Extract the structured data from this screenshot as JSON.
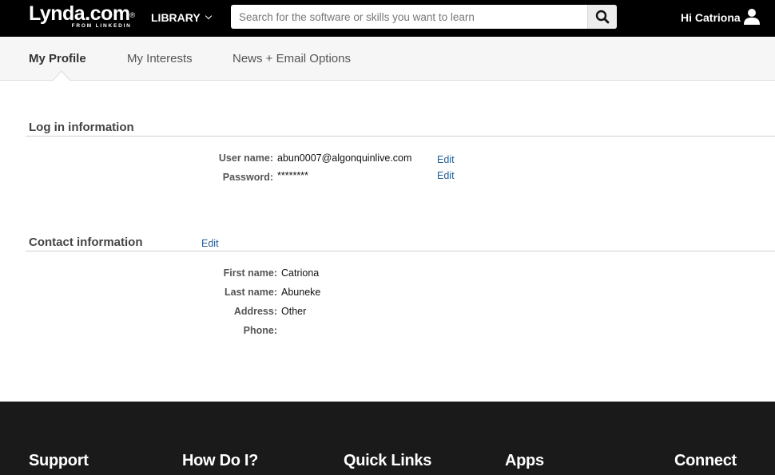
{
  "header": {
    "logo_main": "Lynda.com",
    "logo_reg": "®",
    "logo_sub": "FROM LINKEDIN",
    "library_label": "LIBRARY",
    "search_placeholder": "Search for the software or skills you want to learn",
    "search_value": "",
    "greeting": "Hi Catriona",
    "icons": {
      "search": "search-icon",
      "user": "user-icon",
      "library": "chevron-down-icon"
    }
  },
  "tabs": [
    {
      "label": "My Profile",
      "active": true
    },
    {
      "label": "My Interests",
      "active": false
    },
    {
      "label": "News + Email Options",
      "active": false
    }
  ],
  "login": {
    "title": "Log in information",
    "username_label": "User name:",
    "username_value": "abun0007@algonquinlive.com",
    "password_label": "Password:",
    "password_value": "********",
    "edit_label": "Edit"
  },
  "contact": {
    "title": "Contact information",
    "edit_label": "Edit",
    "fields": [
      {
        "label": "First name:",
        "value": "Catriona"
      },
      {
        "label": "Last name:",
        "value": "Abuneke"
      },
      {
        "label": "Address:",
        "value": "Other"
      },
      {
        "label": "Phone:",
        "value": ""
      }
    ]
  },
  "footer": {
    "headings": [
      "Support",
      "How Do I?",
      "Quick Links",
      "Apps",
      "Connect"
    ]
  },
  "colors": {
    "topbar": "#000000",
    "tabs_bg": "#f6f6f6",
    "link": "#2b5b8c",
    "footer": "#1a1a1a"
  }
}
